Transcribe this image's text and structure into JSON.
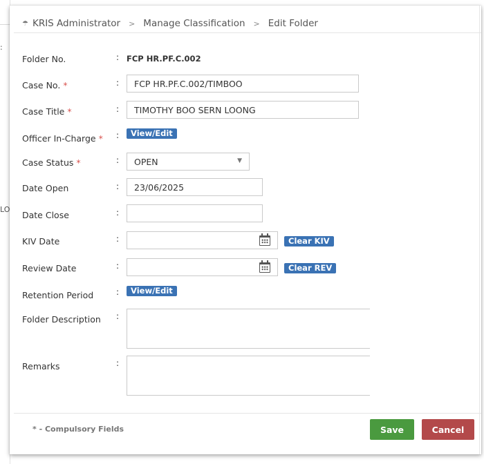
{
  "background": {
    "fragments": [
      ":",
      "LO"
    ]
  },
  "breadcrumb": {
    "home_icon": "home-icon",
    "items": [
      "KRIS Administrator",
      "Manage Classification",
      "Edit Folder"
    ]
  },
  "form": {
    "folder_no": {
      "label": "Folder No.",
      "value": "FCP HR.PF.C.002"
    },
    "case_no": {
      "label": "Case No.",
      "required_mark": "*",
      "value": "FCP HR.PF.C.002/TIMBOO"
    },
    "case_title": {
      "label": "Case Title",
      "required_mark": "*",
      "value": "TIMOTHY BOO SERN LOONG"
    },
    "officer_in_charge": {
      "label": "Officer In-Charge",
      "required_mark": "*",
      "action": "View/Edit"
    },
    "case_status": {
      "label": "Case Status",
      "required_mark": "*",
      "value": "OPEN"
    },
    "date_open": {
      "label": "Date Open",
      "value": "23/06/2025"
    },
    "date_close": {
      "label": "Date Close",
      "value": ""
    },
    "kiv_date": {
      "label": "KIV Date",
      "value": "",
      "clear_label": "Clear KIV"
    },
    "review_date": {
      "label": "Review Date",
      "value": "",
      "clear_label": "Clear REV"
    },
    "retention_period": {
      "label": "Retention Period",
      "action": "View/Edit"
    },
    "folder_description": {
      "label": "Folder Description",
      "value": ""
    },
    "remarks": {
      "label": "Remarks",
      "value": ""
    },
    "colon": ":"
  },
  "footer": {
    "note": "* - Compulsory Fields",
    "save_label": "Save",
    "cancel_label": "Cancel"
  },
  "colors": {
    "badge": "#3a72b4",
    "save": "#4a9a3f",
    "cancel": "#b3494a",
    "required": "#d9534f"
  }
}
